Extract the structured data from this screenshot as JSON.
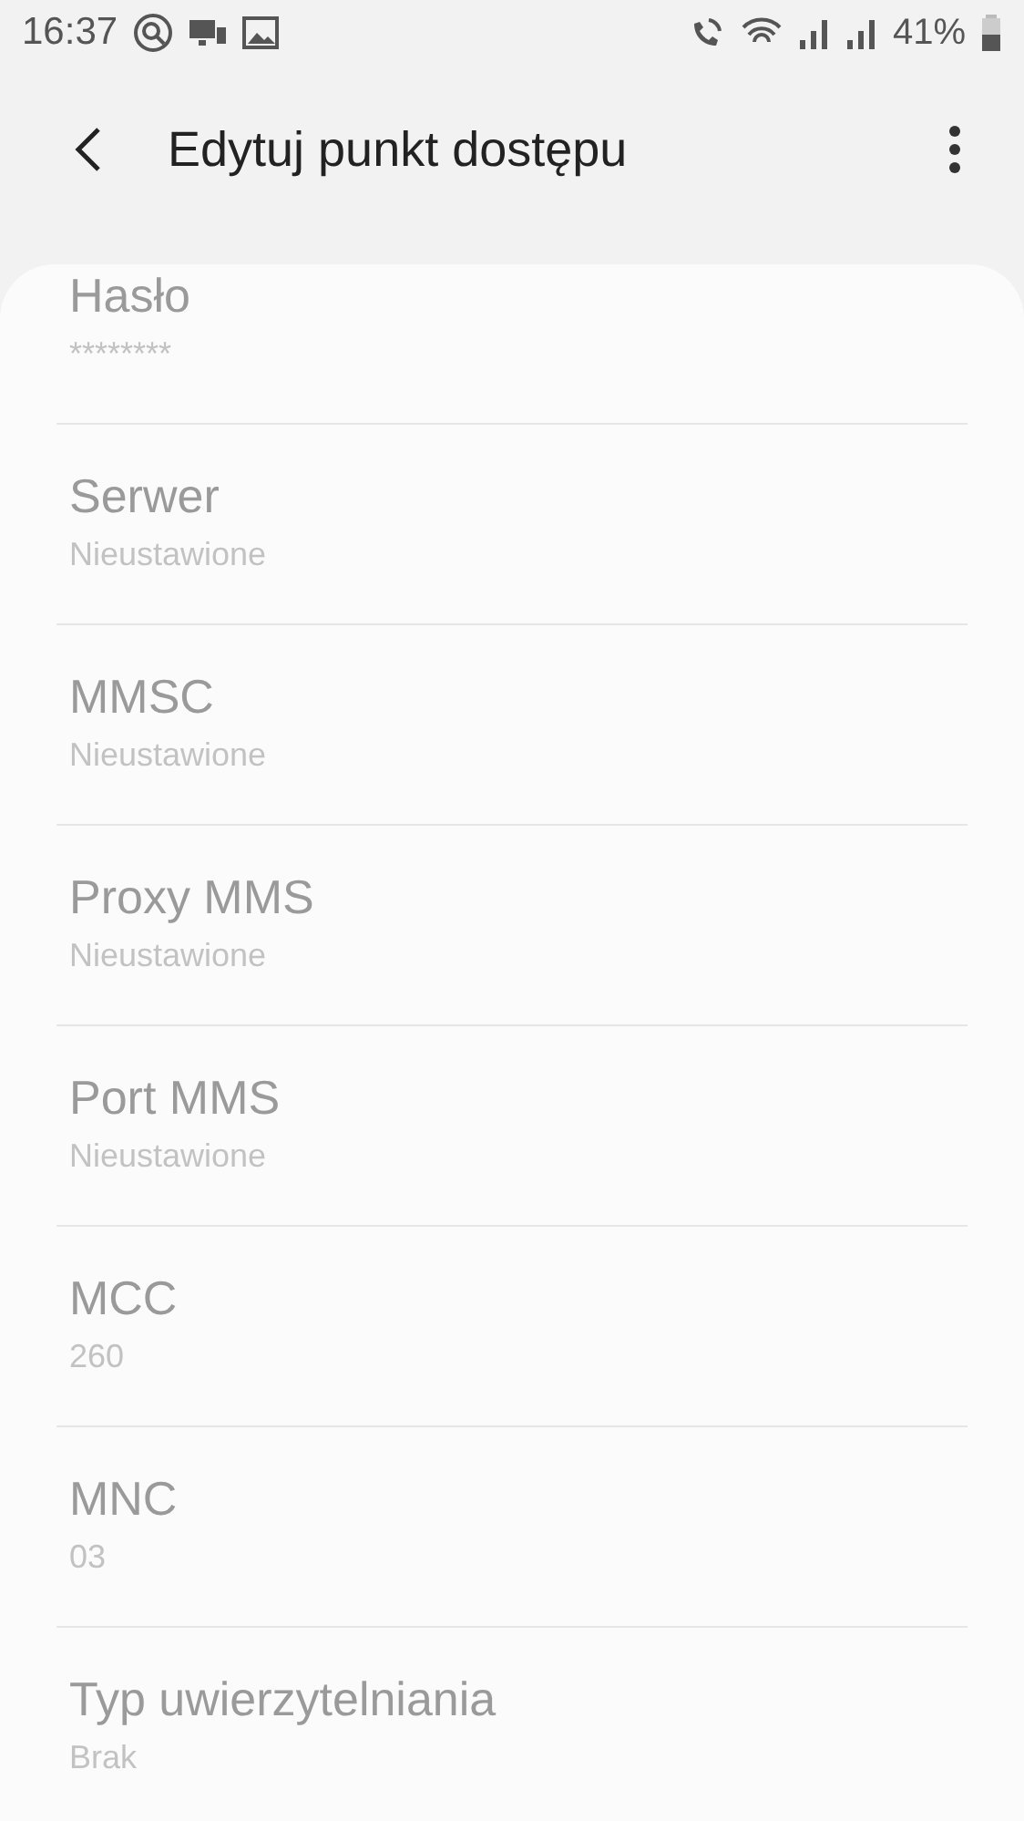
{
  "status_bar": {
    "time": "16:37",
    "battery": "41%"
  },
  "toolbar": {
    "title": "Edytuj punkt dostępu"
  },
  "fields": [
    {
      "label": "Hasło",
      "value": "********",
      "disabled": true
    },
    {
      "label": "Serwer",
      "value": "Nieustawione",
      "disabled": true
    },
    {
      "label": "MMSC",
      "value": "Nieustawione",
      "disabled": true
    },
    {
      "label": "Proxy MMS",
      "value": "Nieustawione",
      "disabled": true
    },
    {
      "label": "Port MMS",
      "value": "Nieustawione",
      "disabled": true
    },
    {
      "label": "MCC",
      "value": "260",
      "disabled": true
    },
    {
      "label": "MNC",
      "value": "03",
      "disabled": true
    },
    {
      "label": "Typ uwierzytelniania",
      "value": "Brak",
      "disabled": true
    }
  ]
}
